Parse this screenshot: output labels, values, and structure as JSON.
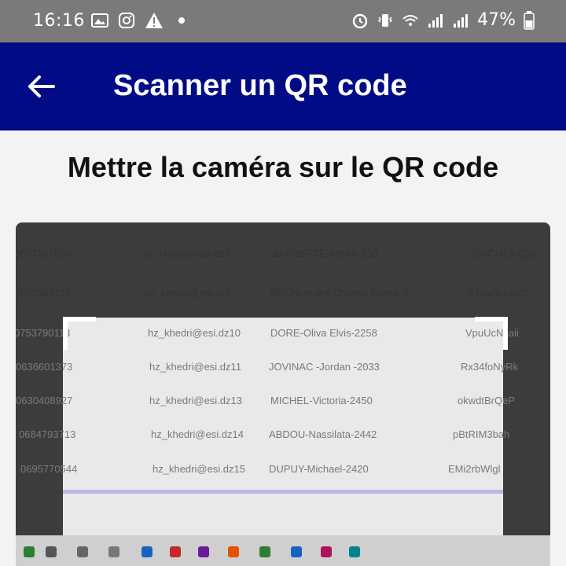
{
  "status_bar": {
    "time": "16:16",
    "battery": "47%",
    "left_icons": [
      "image-icon",
      "instagram-icon",
      "warning-icon",
      "dot-icon"
    ],
    "right_icons": [
      "alarm-icon",
      "vibrate-icon",
      "wifi-icon",
      "signal-icon",
      "signal-icon",
      "battery-icon"
    ]
  },
  "app_bar": {
    "back_icon": "arrow-left-icon",
    "title": "Scanner un QR code",
    "color": "#000b85"
  },
  "instruction": "Mettre la caméra sur le QR code",
  "camera_preview": {
    "rows": [
      {
        "num": "0657107095",
        "email": "hz_khedri@esi.dz8",
        "name": "BARBETTE-Arthur-330",
        "code": "DMCH1XXQp"
      },
      {
        "num": "0622686127",
        "email": "hz_khedri@esi.dz9",
        "name": "BRUN-André Charles Rémy -7...",
        "code": "B3wy6LKqXS"
      },
      {
        "num": "0753790113",
        "email": "hz_khedri@esi.dz10",
        "name": "DORE-Oliva Elvis-2258",
        "code": "VpuUcNsaii"
      },
      {
        "num": "0636601373",
        "email": "hz_khedri@esi.dz11",
        "name": "JOVINAC -Jordan -2033",
        "code": "Rx34foNyRk"
      },
      {
        "num": "0630408927",
        "email": "hz_khedri@esi.dz13",
        "name": "MICHEL-Victoria-2450",
        "code": "okwdtBrQeP"
      },
      {
        "num": "0684793713",
        "email": "hz_khedri@esi.dz14",
        "name": "ABDOU-Nassilata-2442",
        "code": "pBtRIM3bah"
      },
      {
        "num": "0695770544",
        "email": "hz_khedri@esi.dz15",
        "name": "DUPUY-Michael-2420",
        "code": "EMi2rbWlgl"
      }
    ]
  }
}
